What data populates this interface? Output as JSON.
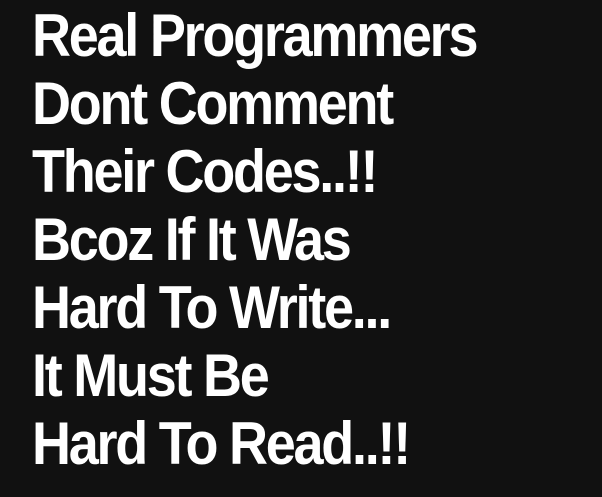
{
  "poster": {
    "lines": [
      "Real Programmers",
      "Dont Comment",
      "Their Codes..!!",
      "Bcoz If It Was",
      "Hard To Write...",
      "It Must Be",
      "Hard To Read..!!"
    ],
    "background_color": "#111111",
    "text_color": "#ffffff"
  }
}
